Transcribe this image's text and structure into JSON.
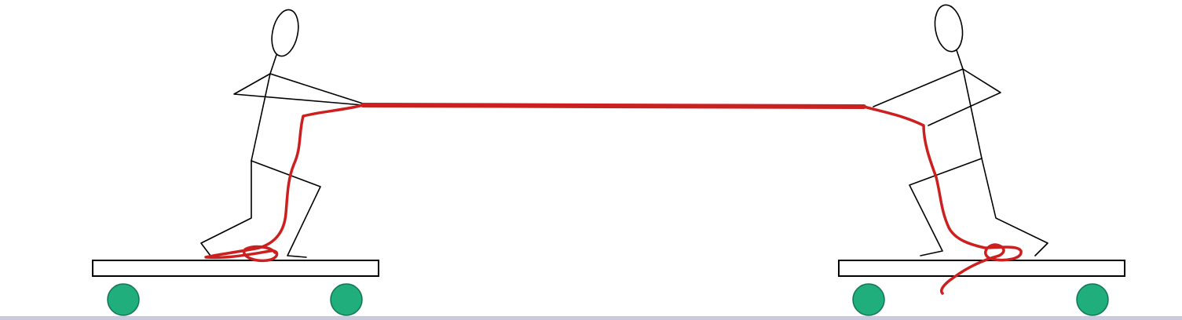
{
  "scene": {
    "figures": [
      {
        "id": "left",
        "facing": "right",
        "description_icon": "stick-figure-icon"
      },
      {
        "id": "right",
        "facing": "left",
        "description_icon": "stick-figure-icon"
      }
    ],
    "carts": [
      {
        "id": "left",
        "wheels": 2
      },
      {
        "id": "right",
        "wheels": 2
      }
    ],
    "rope": {
      "count": 1
    }
  },
  "colors": {
    "background": "#ffffff",
    "figure_stroke": "#000000",
    "rope": "#cc1f1f",
    "cart_fill": "#ffffff",
    "cart_stroke": "#000000",
    "wheel_fill": "#1fae7c",
    "wheel_stroke": "#127552",
    "ground": "#c9cbdc"
  }
}
